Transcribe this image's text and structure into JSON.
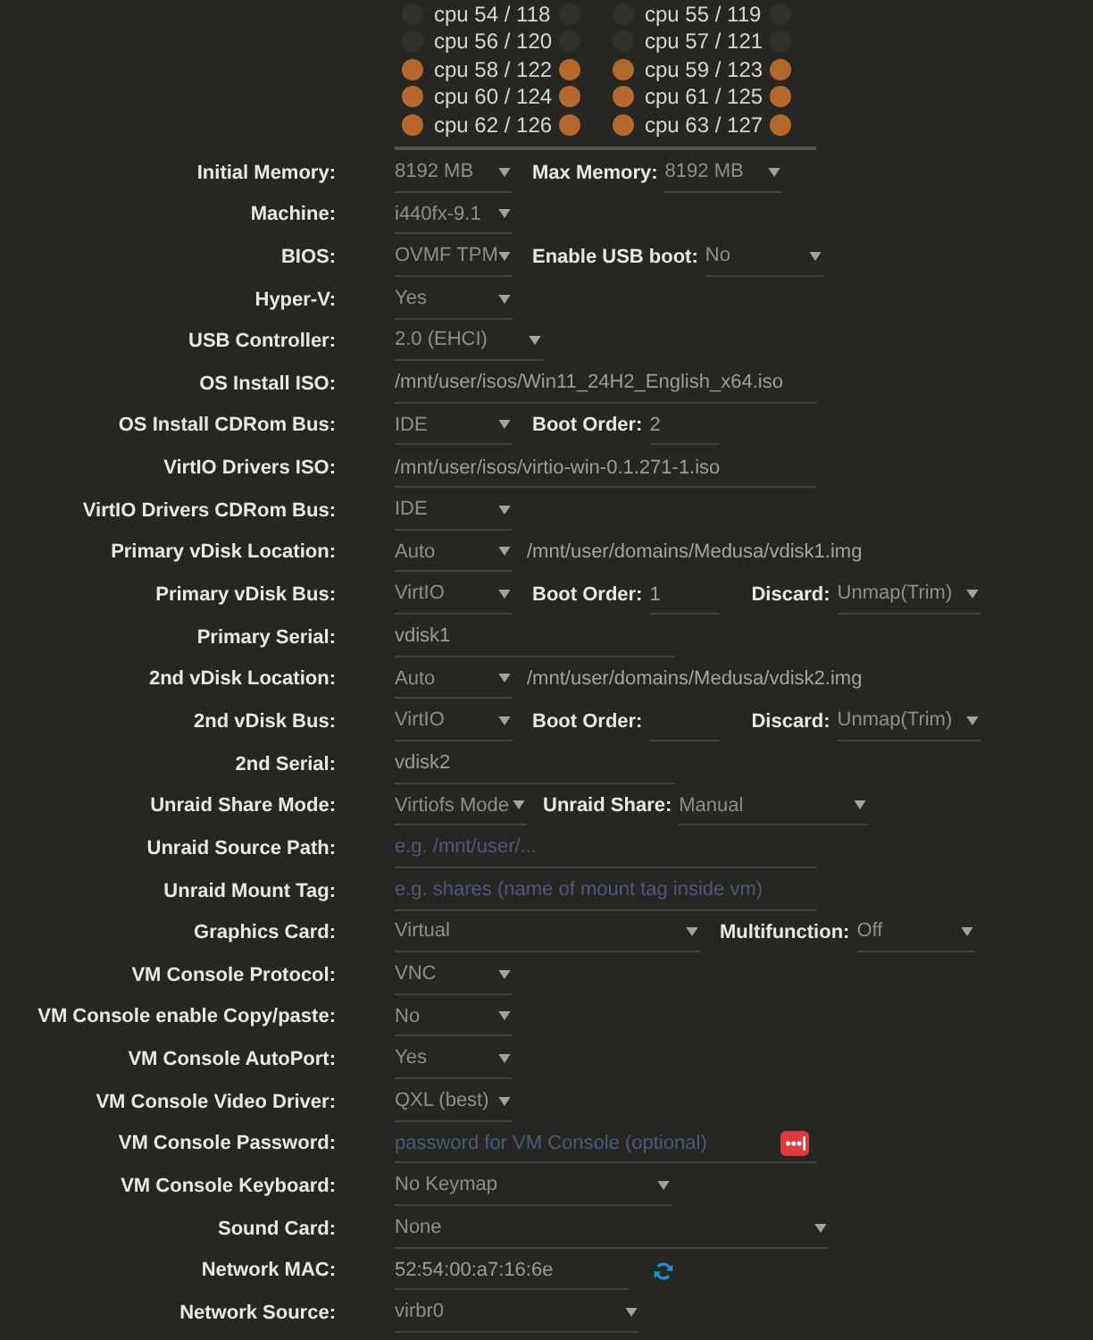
{
  "cpu_pinning": [
    {
      "label": "cpu 54 / 118",
      "left_checked": false,
      "right_checked": false
    },
    {
      "label": "cpu 55 / 119",
      "left_checked": false,
      "right_checked": false
    },
    {
      "label": "cpu 56 / 120",
      "left_checked": false,
      "right_checked": false
    },
    {
      "label": "cpu 57 / 121",
      "left_checked": false,
      "right_checked": false
    },
    {
      "label": "cpu 58 / 122",
      "left_checked": true,
      "right_checked": true
    },
    {
      "label": "cpu 59 / 123",
      "left_checked": true,
      "right_checked": true
    },
    {
      "label": "cpu 60 / 124",
      "left_checked": true,
      "right_checked": true
    },
    {
      "label": "cpu 61 / 125",
      "left_checked": true,
      "right_checked": true
    },
    {
      "label": "cpu 62 / 126",
      "left_checked": true,
      "right_checked": true
    },
    {
      "label": "cpu 63 / 127",
      "left_checked": true,
      "right_checked": true
    }
  ],
  "settings": [
    {
      "label": "Initial Memory:",
      "controls": [
        {
          "kind": "select",
          "value": "8192 MB"
        },
        {
          "kind": "label",
          "text": "Max Memory:"
        },
        {
          "kind": "select",
          "value": "8192 MB"
        }
      ]
    },
    {
      "label": "Machine:",
      "controls": [
        {
          "kind": "select",
          "value": "i440fx-9.1"
        }
      ]
    },
    {
      "label": "BIOS:",
      "controls": [
        {
          "kind": "select",
          "value": "OVMF TPM"
        },
        {
          "kind": "label",
          "text": "Enable USB boot:"
        },
        {
          "kind": "select",
          "value": "No"
        }
      ]
    },
    {
      "label": "Hyper-V:",
      "controls": [
        {
          "kind": "select",
          "value": "Yes"
        }
      ]
    },
    {
      "label": "USB Controller:",
      "controls": [
        {
          "kind": "select",
          "value": "2.0 (EHCI)"
        }
      ]
    },
    {
      "label": "OS Install ISO:",
      "controls": [
        {
          "kind": "input",
          "value": "/mnt/user/isos/Win11_24H2_English_x64.iso"
        }
      ]
    },
    {
      "label": "OS Install CDRom Bus:",
      "controls": [
        {
          "kind": "select",
          "value": "IDE"
        },
        {
          "kind": "label",
          "text": "Boot Order:"
        },
        {
          "kind": "input",
          "value": "2"
        }
      ]
    },
    {
      "label": "VirtIO Drivers ISO:",
      "controls": [
        {
          "kind": "input",
          "value": "/mnt/user/isos/virtio-win-0.1.271-1.iso"
        }
      ]
    },
    {
      "label": "VirtIO Drivers CDRom Bus:",
      "controls": [
        {
          "kind": "select",
          "value": "IDE"
        }
      ]
    },
    {
      "label": "Primary vDisk Location:",
      "controls": [
        {
          "kind": "select",
          "value": "Auto"
        },
        {
          "kind": "path",
          "text": "/mnt/user/domains/Medusa/vdisk1.img"
        }
      ]
    },
    {
      "label": "Primary vDisk Bus:",
      "controls": [
        {
          "kind": "select",
          "value": "VirtIO"
        },
        {
          "kind": "label",
          "text": "Boot Order:"
        },
        {
          "kind": "input",
          "value": "1"
        },
        {
          "kind": "label",
          "text": "Discard:"
        },
        {
          "kind": "select",
          "value": "Unmap(Trim)"
        }
      ]
    },
    {
      "label": "Primary Serial:",
      "controls": [
        {
          "kind": "input",
          "value": "vdisk1"
        }
      ]
    },
    {
      "label": "2nd vDisk Location:",
      "controls": [
        {
          "kind": "select",
          "value": "Auto"
        },
        {
          "kind": "path",
          "text": "/mnt/user/domains/Medusa/vdisk2.img"
        }
      ]
    },
    {
      "label": "2nd vDisk Bus:",
      "controls": [
        {
          "kind": "select",
          "value": "VirtIO"
        },
        {
          "kind": "label",
          "text": "Boot Order:"
        },
        {
          "kind": "input"
        },
        {
          "kind": "label",
          "text": "Discard:"
        },
        {
          "kind": "select",
          "value": "Unmap(Trim)"
        }
      ]
    },
    {
      "label": "2nd Serial:",
      "controls": [
        {
          "kind": "input",
          "value": "vdisk2"
        }
      ]
    },
    {
      "label": "Unraid Share Mode:",
      "controls": [
        {
          "kind": "select",
          "value": "Virtiofs Mode"
        },
        {
          "kind": "label",
          "text": "Unraid Share:"
        },
        {
          "kind": "select",
          "value": "Manual"
        }
      ]
    },
    {
      "label": "Unraid Source Path:",
      "controls": [
        {
          "kind": "input",
          "placeholder": "e.g. /mnt/user/..."
        }
      ]
    },
    {
      "label": "Unraid Mount Tag:",
      "controls": [
        {
          "kind": "input",
          "placeholder": "e.g. shares (name of mount tag inside vm)"
        }
      ]
    },
    {
      "label": "Graphics Card:",
      "controls": [
        {
          "kind": "select",
          "value": "Virtual"
        },
        {
          "kind": "label",
          "text": "Multifunction:"
        },
        {
          "kind": "select",
          "value": "Off"
        }
      ]
    },
    {
      "label": "VM Console Protocol:",
      "controls": [
        {
          "kind": "select",
          "value": "VNC"
        }
      ]
    },
    {
      "label": "VM Console enable Copy/paste:",
      "controls": [
        {
          "kind": "select",
          "value": "No"
        }
      ]
    },
    {
      "label": "VM Console AutoPort:",
      "controls": [
        {
          "kind": "select",
          "value": "Yes"
        }
      ]
    },
    {
      "label": "VM Console Video Driver:",
      "controls": [
        {
          "kind": "select",
          "value": "QXL (best)"
        }
      ]
    },
    {
      "label": "VM Console Password:",
      "controls": [
        {
          "kind": "password_input",
          "placeholder": "password for VM Console (optional)"
        }
      ]
    },
    {
      "label": "VM Console Keyboard:",
      "controls": [
        {
          "kind": "select",
          "value": "No Keymap"
        }
      ]
    },
    {
      "label": "Sound Card:",
      "controls": [
        {
          "kind": "select",
          "value": "None"
        }
      ]
    },
    {
      "label": "Network MAC:",
      "controls": [
        {
          "kind": "mac_input",
          "value": "52:54:00:a7:16:6e"
        }
      ]
    },
    {
      "label": "Network Source:",
      "controls": [
        {
          "kind": "select",
          "value": "virbr0"
        }
      ]
    }
  ]
}
